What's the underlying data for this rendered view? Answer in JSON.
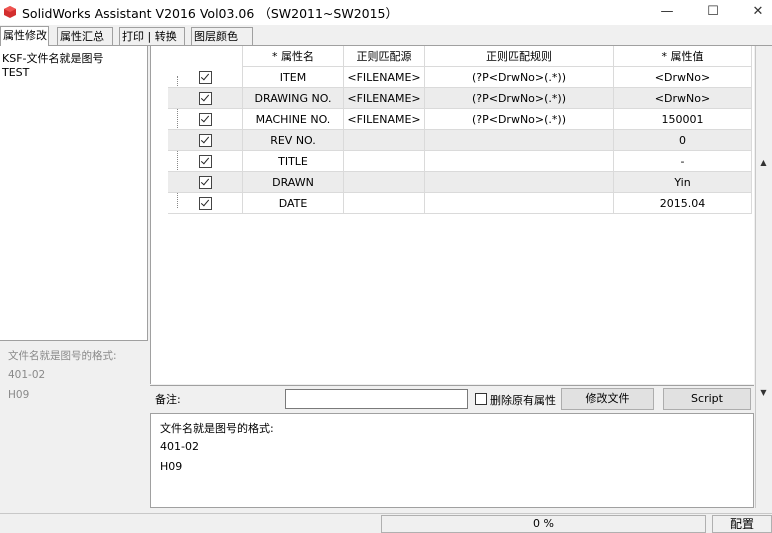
{
  "window": {
    "title": "SolidWorks Assistant V2016 Vol03.06 （SW2011~SW2015）",
    "minimize": "—",
    "maximize": "☐",
    "close": "✕"
  },
  "tabs": [
    {
      "label": "属性修改"
    },
    {
      "label": "属性汇总"
    },
    {
      "label": "打印 | 转换"
    },
    {
      "label": "图层颜色"
    }
  ],
  "left": {
    "items": [
      "KSF-文件名就是图号",
      "TEST"
    ],
    "info": [
      "文件名就是图号的格式:",
      "401-02",
      "H09"
    ]
  },
  "grid": {
    "headers": [
      "* 属性名",
      "正则匹配源",
      "正则匹配规则",
      "* 属性值"
    ],
    "rows": [
      {
        "name": "ITEM",
        "source": "<FILENAME>",
        "rule": "(?P<DrwNo>(.*))",
        "value": "<DrwNo>"
      },
      {
        "name": "DRAWING NO.",
        "source": "<FILENAME>",
        "rule": "(?P<DrwNo>(.*))",
        "value": "<DrwNo>"
      },
      {
        "name": "MACHINE NO.",
        "source": "<FILENAME>",
        "rule": "(?P<DrwNo>(.*))",
        "value": "150001"
      },
      {
        "name": "REV NO.",
        "source": "",
        "rule": "",
        "value": "0"
      },
      {
        "name": "TITLE",
        "source": "",
        "rule": "",
        "value": "-"
      },
      {
        "name": "DRAWN",
        "source": "",
        "rule": "",
        "value": "Yin"
      },
      {
        "name": "DATE",
        "source": "",
        "rule": "",
        "value": "2015.04"
      }
    ]
  },
  "remark": {
    "label": "备注:",
    "value": "",
    "delete_label": "删除原有属性",
    "modify_button": "修改文件",
    "script_button": "Script"
  },
  "bottom_text": [
    "文件名就是图号的格式:",
    "401-02",
    "H09"
  ],
  "status": {
    "progress": "0 %",
    "config_button": "配置"
  }
}
